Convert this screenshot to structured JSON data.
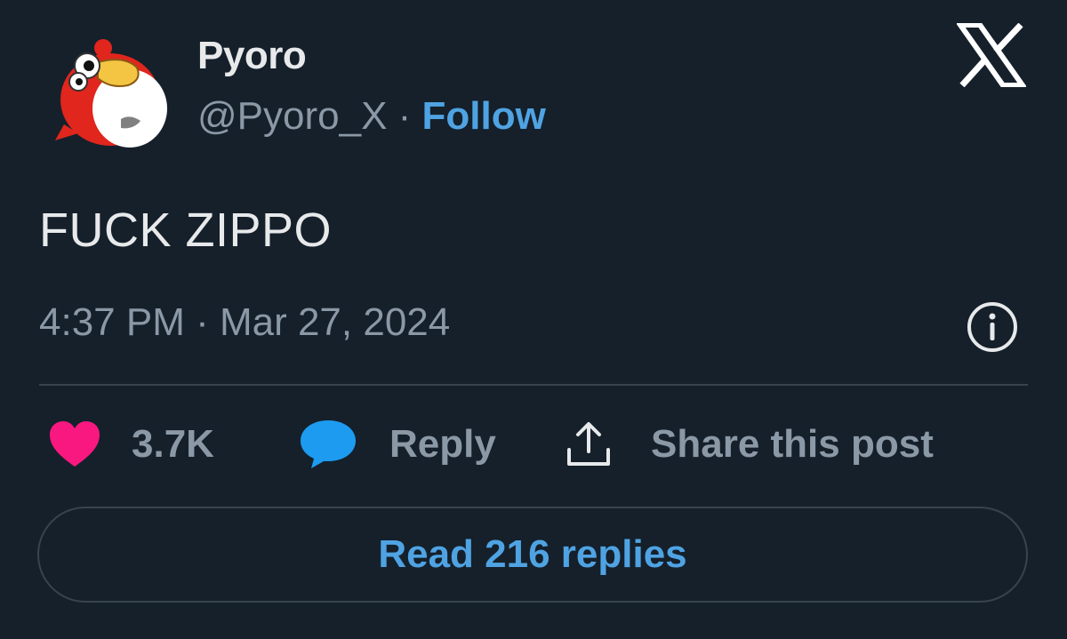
{
  "author": {
    "display_name": "Pyoro",
    "handle": "@Pyoro_X",
    "separator": " · ",
    "follow_label": "Follow"
  },
  "post": {
    "text": "FUCK ZIPPO",
    "timestamp": "4:37 PM · Mar 27, 2024"
  },
  "actions": {
    "like_count": "3.7K",
    "reply_label": "Reply",
    "share_label": "Share this post"
  },
  "read_replies_label": "Read 216 replies",
  "icons": {
    "brand": "x-logo-icon",
    "info": "info-icon",
    "like": "heart-icon",
    "reply": "speech-bubble-icon",
    "share": "share-arrow-icon"
  },
  "colors": {
    "background": "#15202b",
    "text_primary": "#e7e9ea",
    "text_secondary": "#8b98a5",
    "link": "#4fa3e3",
    "heart": "#f91880",
    "reply_bubble": "#1d9bf0",
    "border": "#38444d"
  }
}
